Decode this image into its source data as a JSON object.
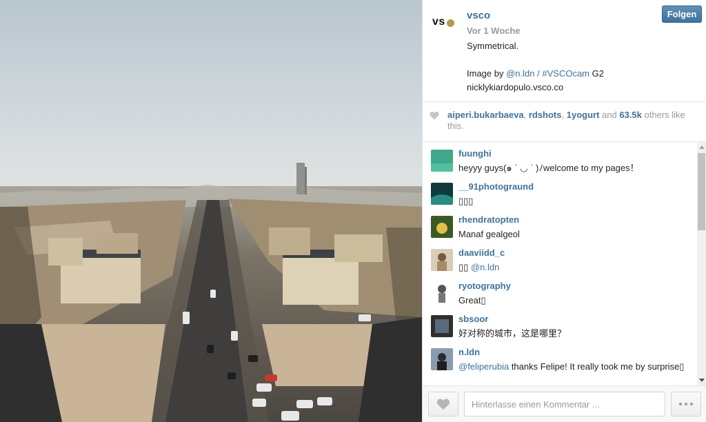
{
  "photo": {
    "alt_subject": "aerial-city-avenue"
  },
  "post": {
    "logo_text": "vs",
    "username": "vsco",
    "time": "Vor 1 Woche",
    "caption_line1": "Symmetrical.",
    "caption_prefix": "Image by",
    "caption_mention": "@n.ldn",
    "caption_sep": "/",
    "caption_hashtag": "#VSCOcam",
    "caption_suffix": "G2",
    "caption_line4": "nicklykiardopulo.vsco.co",
    "follow_label": "Folgen"
  },
  "likes": {
    "user1": "aiperi.bukarbaeva",
    "sep1": ",",
    "user2": "rdshots",
    "sep2": ",",
    "user3": "1yogurt",
    "and": "and",
    "count": "63.5k",
    "others": "others like this."
  },
  "comments": [
    {
      "user": "fuunghi",
      "text": "heyyy guys(๑ ˈ ◡ ˈ )ﾉwelcome to my pages！",
      "avatar_color": "#3fa88a"
    },
    {
      "user": "__91photograund",
      "text": "▯▯▯",
      "avatar_color": "#2a6b6a"
    },
    {
      "user": "rhendratopten",
      "text": "Manaf gealgeol",
      "avatar_color": "#4a6a2a"
    },
    {
      "user": "daaviidd_c",
      "text_prefix": "▯▯",
      "mention": "@n.ldn",
      "avatar_color": "#c9b8a0"
    },
    {
      "user": "ryotography",
      "text": "Great▯",
      "avatar_color": "#ffffff"
    },
    {
      "user": "sbsoor",
      "text": "好对称的城市，这是哪里？",
      "avatar_color": "#3a3a3a"
    },
    {
      "user": "n.ldn",
      "mention": "@feliperubia",
      "text_suffix": "thanks Felipe! It really took me by surprise▯",
      "avatar_color": "#6b7f95"
    }
  ],
  "footer": {
    "comment_placeholder": "Hinterlasse einen Kommentar ..."
  },
  "colors": {
    "link": "#3f729b",
    "muted": "#999999",
    "follow_button": "#3f729b"
  }
}
